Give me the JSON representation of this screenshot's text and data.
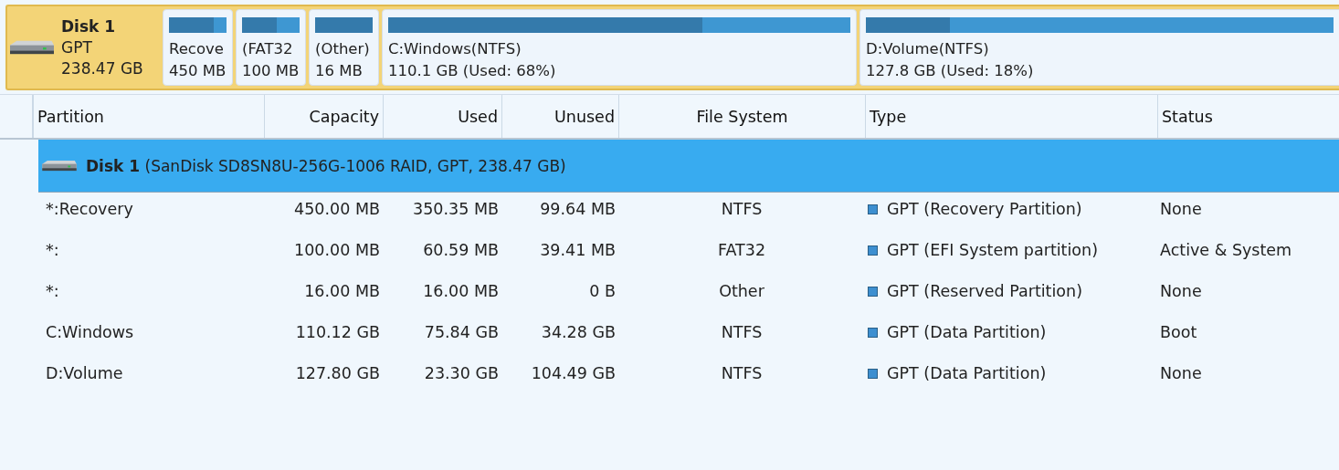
{
  "disk_map": {
    "disk": {
      "name": "Disk 1",
      "style": "GPT",
      "size": "238.47 GB",
      "selected": true
    },
    "partitions": [
      {
        "label": "Recove",
        "size": "450 MB",
        "level": 0.78
      },
      {
        "label": "(FAT32",
        "size": "100 MB",
        "level": 0.6
      },
      {
        "label": "(Other)",
        "size": "16 MB",
        "level": 1
      },
      {
        "label": "C:Windows(NTFS)",
        "size": "110.1 GB (Used: 68%)",
        "level": 0.68
      },
      {
        "label": "D:Volume(NTFS)",
        "size": "127.8 GB (Used: 18%)",
        "level": 0.18
      }
    ]
  },
  "table": {
    "columns": [
      "Partition",
      "Capacity",
      "Used",
      "Unused",
      "File System",
      "Type",
      "Status"
    ],
    "disk_row": {
      "name": "Disk 1",
      "detail": "(SanDisk SD8SN8U-256G-1006 RAID, GPT, 238.47 GB)",
      "selected": true
    },
    "rows": [
      [
        "*:Recovery",
        "450.00 MB",
        "350.35 MB",
        "99.64 MB",
        "NTFS",
        "GPT (Recovery Partition)",
        "None"
      ],
      [
        "*:",
        "100.00 MB",
        "60.59 MB",
        "39.41 MB",
        "FAT32",
        "GPT (EFI System partition)",
        "Active & System"
      ],
      [
        "*:",
        "16.00 MB",
        "16.00 MB",
        "0 B",
        "Other",
        "GPT (Reserved Partition)",
        "None"
      ],
      [
        "C:Windows",
        "110.12 GB",
        "75.84 GB",
        "34.28 GB",
        "NTFS",
        "GPT (Data Partition)",
        "Boot"
      ],
      [
        "D:Volume",
        "127.80 GB",
        "23.30 GB",
        "104.49 GB",
        "NTFS",
        "GPT (Data Partition)",
        "None"
      ]
    ]
  }
}
